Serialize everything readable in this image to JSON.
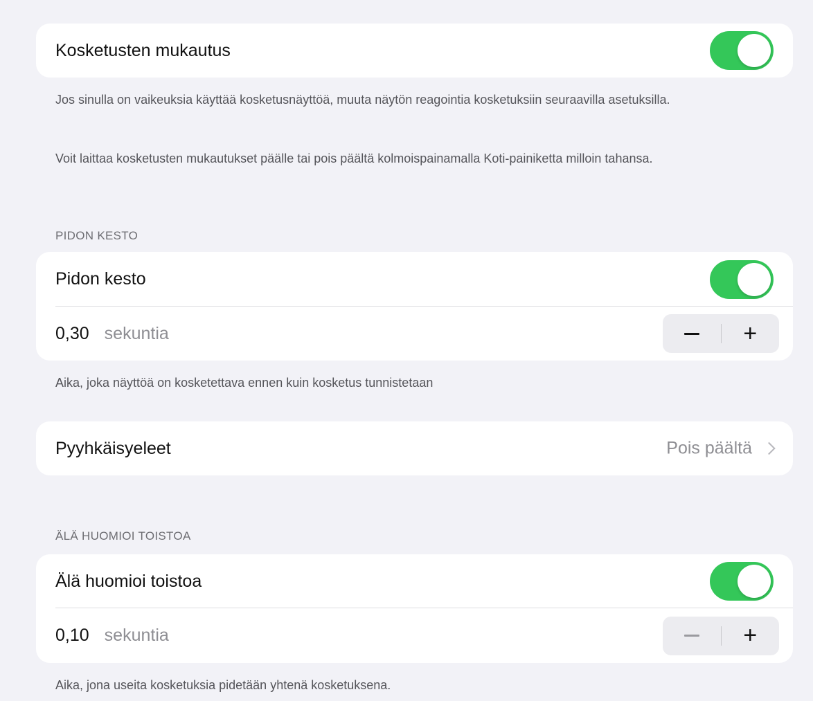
{
  "touch_accommodations": {
    "title": "Kosketusten mukautus",
    "enabled": true,
    "footer_1": "Jos sinulla on vaikeuksia käyttää kosketusnäyttöä, muuta näytön reagointia kosketuksiin seuraavilla asetuksilla.",
    "footer_2": "Voit laittaa kosketusten mukautukset päälle tai pois päältä kolmoispainamalla Koti-painiketta milloin tahansa."
  },
  "hold_duration": {
    "section_header": "PIDON KESTO",
    "title": "Pidon kesto",
    "enabled": true,
    "value": "0,30",
    "unit": "sekuntia",
    "minus": "−",
    "plus": "+",
    "footer": "Aika, joka näyttöä on kosketettava ennen kuin kosketus tunnistetaan"
  },
  "swipe_gestures": {
    "title": "Pyyhkäisyeleet",
    "value": "Pois päältä"
  },
  "ignore_repeat": {
    "section_header": "ÄLÄ HUOMIOI TOISTOA",
    "title": "Älä huomioi toistoa",
    "enabled": true,
    "value": "0,10",
    "unit": "sekuntia",
    "minus": "−",
    "plus": "+",
    "footer": "Aika, jona useita kosketuksia pidetään yhtenä kosketuksena."
  },
  "colors": {
    "toggle_on": "#34c759",
    "background": "#f2f2f7"
  }
}
